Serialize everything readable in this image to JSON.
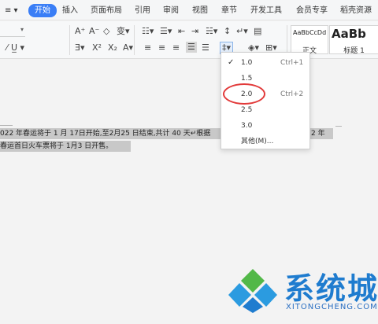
{
  "menu": {
    "tabs": [
      "开始",
      "插入",
      "页面布局",
      "引用",
      "审阅",
      "视图",
      "章节",
      "开发工具",
      "会员专享",
      "稻壳资源"
    ],
    "active": "开始",
    "accent": "#3a7ef6"
  },
  "ribbon": {
    "styles": [
      {
        "sample": "AaBbCcDd",
        "name": "正文"
      },
      {
        "sample": "AaBb",
        "name": "标题 1"
      }
    ],
    "icons": [
      "font-size-increase-icon",
      "font-size-decrease-icon",
      "clear-format-icon",
      "pinyin-icon",
      "bullet-list-icon",
      "numbered-list-icon",
      "decrease-indent-icon",
      "increase-indent-icon",
      "chinese-layout-icon",
      "show-hide-marks-icon",
      "column-icon",
      "superscript-icon",
      "subscript-icon",
      "text-effect-icon",
      "highlight-icon",
      "font-color-icon",
      "char-border-icon",
      "align-left-icon",
      "align-center-icon",
      "align-right-icon",
      "justify-icon",
      "distributed-icon",
      "line-spacing-icon",
      "shading-icon",
      "border-icon"
    ]
  },
  "line_spacing_menu": {
    "items": [
      {
        "value": "1.0",
        "shortcut": "Ctrl+1",
        "checked": true
      },
      {
        "value": "1.5",
        "shortcut": "",
        "checked": false
      },
      {
        "value": "2.0",
        "shortcut": "Ctrl+2",
        "checked": false
      },
      {
        "value": "2.5",
        "shortcut": "",
        "checked": false
      },
      {
        "value": "3.0",
        "shortcut": "",
        "checked": false
      },
      {
        "value": "其他(M)...",
        "shortcut": "",
        "checked": false
      }
    ],
    "highlight_color": "#e23a3a"
  },
  "document": {
    "line1": "022 年春运将于 1 月 17日开始,至2月25 日结束,共计 40 天↵根据",
    "line1_tail": "2 年",
    "line2": "春运首日火车票将于 1月3 日开售。"
  },
  "watermark": {
    "name": "系统城",
    "domain": "XITONGCHENG.COM",
    "colors": [
      "#2b9be0",
      "#52b848",
      "#1f7ccf"
    ]
  }
}
